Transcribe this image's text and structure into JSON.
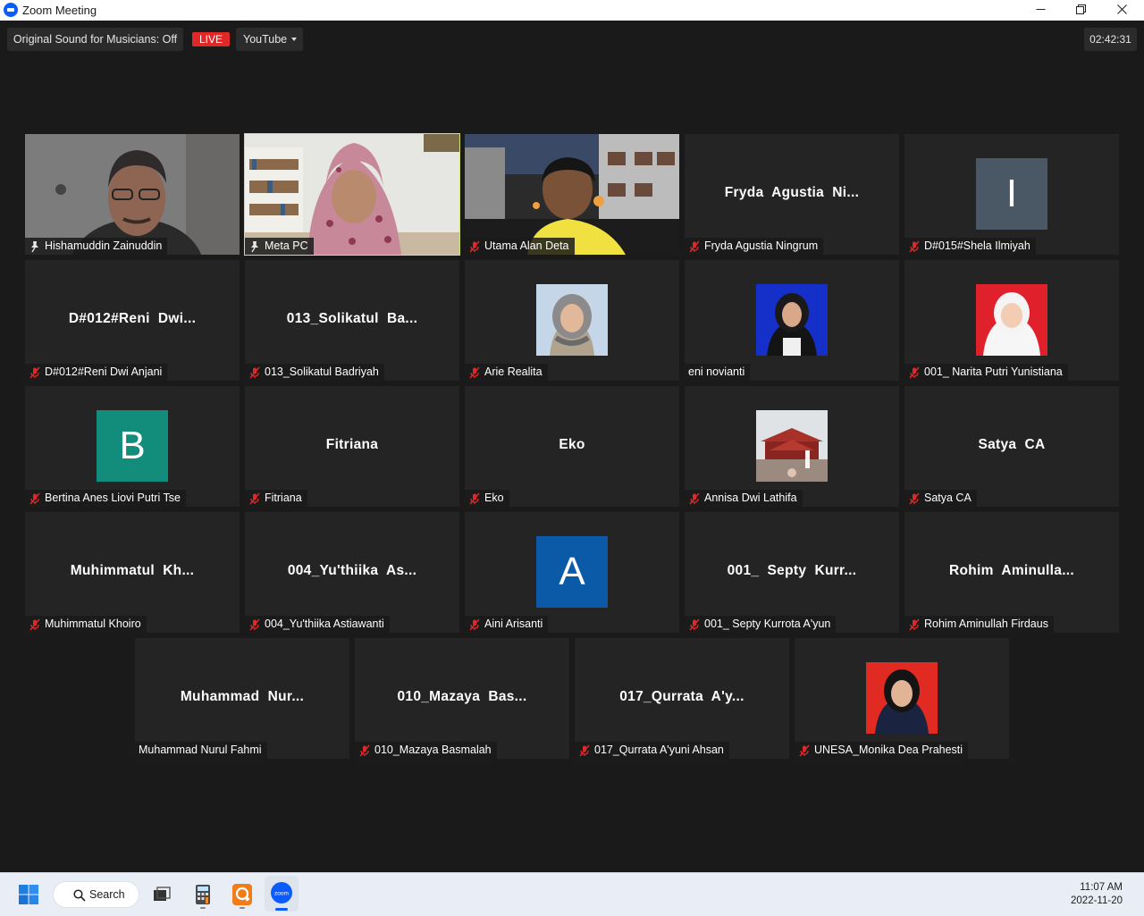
{
  "window": {
    "title": "Zoom Meeting"
  },
  "toolbar": {
    "original_sound": "Original Sound for Musicians: Off",
    "live_label": "LIVE",
    "stream_target": "YouTube",
    "elapsed": "02:42:31"
  },
  "participants": [
    {
      "name": "Hishamuddin Zainuddin",
      "display": "",
      "status": "pin",
      "type": "video"
    },
    {
      "name": "Meta PC",
      "display": "",
      "status": "pin",
      "type": "video",
      "active_speaker": true
    },
    {
      "name": "Utama Alan Deta",
      "display": "",
      "status": "muted",
      "type": "video"
    },
    {
      "name": "Fryda Agustia Ningrum",
      "display": "Fryda  Agustia  Ni...",
      "status": "muted",
      "type": "text"
    },
    {
      "name": "D#015#Shela Ilmiyah",
      "display": "I",
      "status": "muted",
      "type": "avatar",
      "color": "#4a5866"
    },
    {
      "name": "D#012#Reni Dwi Anjani",
      "display": "D#012#Reni  Dwi...",
      "status": "muted",
      "type": "text"
    },
    {
      "name": "013_Solikatul Badriyah",
      "display": "013_Solikatul  Ba...",
      "status": "muted",
      "type": "text"
    },
    {
      "name": "Arie Realita",
      "display": "",
      "status": "muted",
      "type": "photo",
      "photo": "arie"
    },
    {
      "name": "eni novianti",
      "display": "",
      "status": "none",
      "type": "photo",
      "photo": "eni"
    },
    {
      "name": "001_ Narita Putri Yunistiana",
      "display": "",
      "status": "muted",
      "type": "photo",
      "photo": "narita"
    },
    {
      "name": "Bertina Anes Liovi Putri Tse",
      "display": "B",
      "status": "muted",
      "type": "avatar",
      "color": "#128d7c"
    },
    {
      "name": "Fitriana",
      "display": "Fitriana",
      "status": "muted",
      "type": "text"
    },
    {
      "name": "Eko",
      "display": "Eko",
      "status": "muted",
      "type": "text"
    },
    {
      "name": "Annisa Dwi Lathifa",
      "display": "",
      "status": "muted",
      "type": "photo",
      "photo": "annisa"
    },
    {
      "name": "Satya CA",
      "display": "Satya  CA",
      "status": "muted",
      "type": "text"
    },
    {
      "name": "Muhimmatul Khoiro",
      "display": "Muhimmatul  Kh...",
      "status": "muted",
      "type": "text"
    },
    {
      "name": "004_Yu'thiika Astiawanti",
      "display": "004_Yu'thiika  As...",
      "status": "muted",
      "type": "text"
    },
    {
      "name": "Aini Arisanti",
      "display": "A",
      "status": "muted",
      "type": "avatar",
      "color": "#0a5aa8"
    },
    {
      "name": "001_ Septy Kurrota A'yun",
      "display": "001_  Septy  Kurr...",
      "status": "muted",
      "type": "text"
    },
    {
      "name": "Rohim Aminullah Firdaus",
      "display": "Rohim  Aminulla...",
      "status": "muted",
      "type": "text"
    },
    {
      "name": "Muhammad Nurul Fahmi",
      "display": "Muhammad  Nur...",
      "status": "none",
      "type": "text"
    },
    {
      "name": "010_Mazaya Basmalah",
      "display": "010_Mazaya  Bas...",
      "status": "muted",
      "type": "text"
    },
    {
      "name": "017_Qurrata A'yuni Ahsan",
      "display": "017_Qurrata  A'y...",
      "status": "muted",
      "type": "text"
    },
    {
      "name": "UNESA_Monika Dea Prahesti",
      "display": "",
      "status": "muted",
      "type": "photo",
      "photo": "monika"
    }
  ],
  "taskbar": {
    "search_label": "Search",
    "icons": [
      "windows-start-icon",
      "task-view-icon",
      "calculator-icon",
      "pdf-reader-icon",
      "zoom-icon"
    ],
    "zoom_icon_label": "zoom",
    "time": "11:07 AM",
    "date": "2022-11-20"
  },
  "colors": {
    "active_speaker_border": "#d3e46c",
    "live": "#e02828",
    "mic_off": "#e02828",
    "tile_bg": "#242424",
    "background": "#1a1a1a"
  }
}
